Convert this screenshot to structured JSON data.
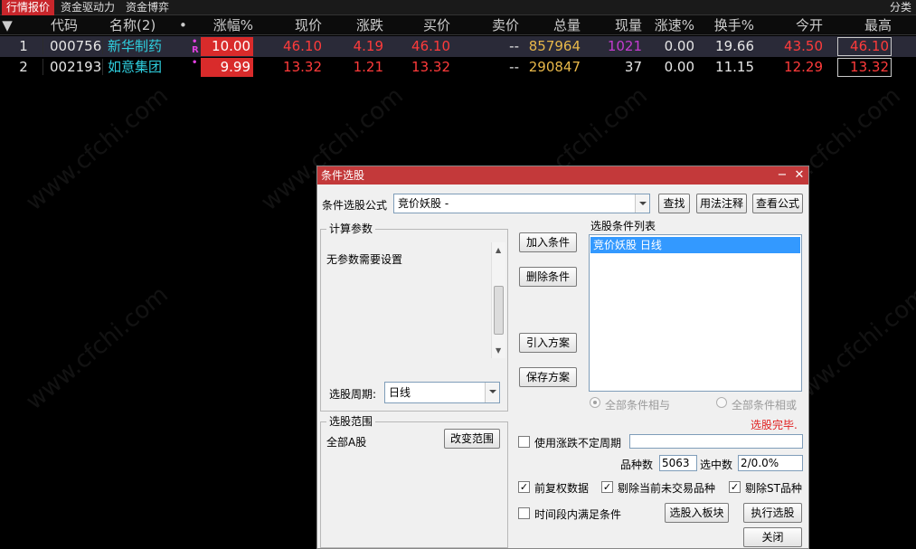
{
  "tabs": {
    "market_quotes": "行情报价",
    "fund_drive": "资金驱动力",
    "fund_game": "资金博弈",
    "category": "分类"
  },
  "table": {
    "columns": [
      "代码",
      "名称(2)",
      "•",
      "涨幅%",
      "现价",
      "涨跌",
      "买价",
      "卖价",
      "总量",
      "现量",
      "涨速%",
      "换手%",
      "今开",
      "最高"
    ],
    "rows": [
      {
        "idx": "1",
        "code": "000756",
        "name": "新华制药",
        "flag": "R",
        "pct": "10.00",
        "price": "46.10",
        "change": "4.19",
        "bid": "46.10",
        "ask": "--",
        "volume": "857964",
        "cur_vol": "1021",
        "speed": "0.00",
        "turnover": "19.66",
        "open": "43.50",
        "high": "46.10"
      },
      {
        "idx": "2",
        "code": "002193",
        "name": "如意集团",
        "flag": "",
        "pct": "9.99",
        "price": "13.32",
        "change": "1.21",
        "bid": "13.32",
        "ask": "--",
        "volume": "290847",
        "cur_vol": "37",
        "speed": "0.00",
        "turnover": "11.15",
        "open": "12.29",
        "high": "13.32"
      }
    ]
  },
  "watermark": "www.cfchi.com",
  "dialog": {
    "title": "条件选股",
    "minimize": "−",
    "close": "✕",
    "formula_label": "条件选股公式",
    "formula_value": "竞价妖股      -",
    "find_btn": "查找",
    "usage_btn": "用法注释",
    "view_formula_btn": "查看公式",
    "calc_params_legend": "计算参数",
    "no_params": "无参数需要设置",
    "period_label": "选股周期:",
    "period_value": "日线",
    "range_legend": "选股范围",
    "range_value": "全部A股",
    "change_range_btn": "改变范围",
    "add_cond_btn": "加入条件",
    "del_cond_btn": "删除条件",
    "import_plan_btn": "引入方案",
    "save_plan_btn": "保存方案",
    "cond_list_label": "选股条件列表",
    "cond_items": [
      "竞价妖股  日线"
    ],
    "all_and": "全部条件相与",
    "all_or": "全部条件相或",
    "status": "选股完毕.",
    "use_variable_period": "使用涨跌不定周期",
    "variety_count_label": "品种数",
    "variety_count": "5063",
    "selected_count_label": "选中数",
    "selected_count": "2/0.0%",
    "pre_adjust": "前复权数据",
    "remove_no_trade": "剔除当前未交易品种",
    "remove_st": "剔除ST品种",
    "time_range": "时间段内满足条件",
    "to_block_btn": "选股入板块",
    "execute_btn": "执行选股",
    "close_btn": "关闭"
  }
}
